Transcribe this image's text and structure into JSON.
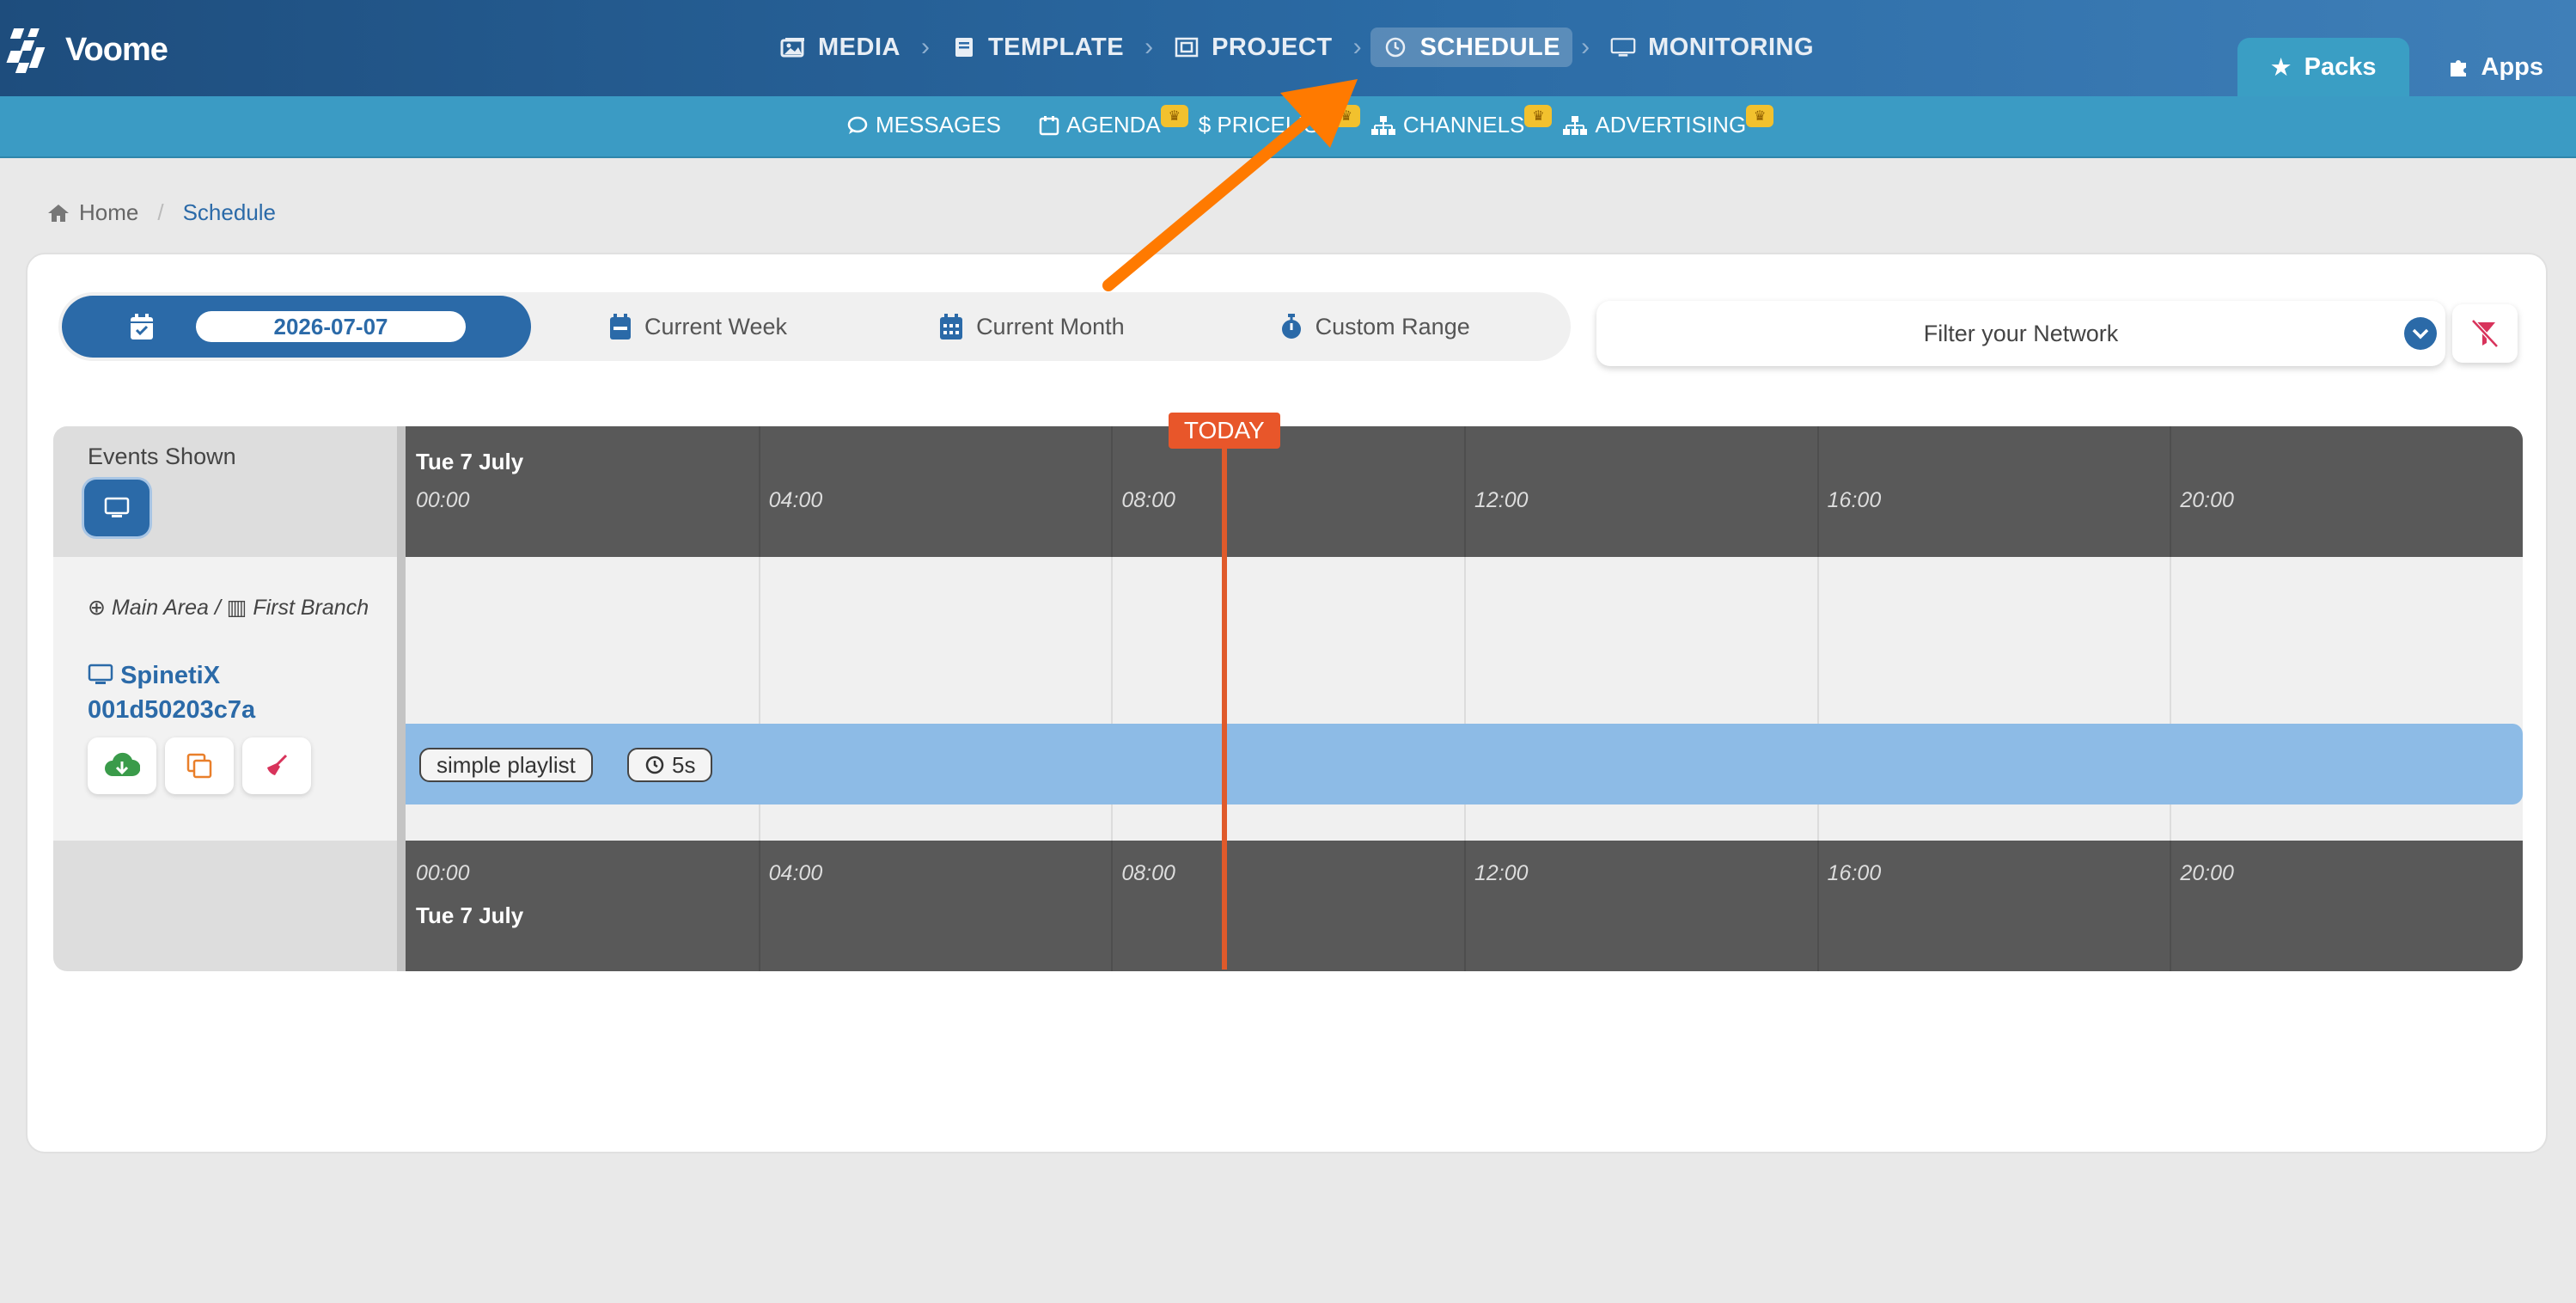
{
  "brand": {
    "name": "Voome"
  },
  "nav": {
    "items": [
      {
        "label": "MEDIA",
        "icon": "image-icon",
        "active": false
      },
      {
        "label": "TEMPLATE",
        "icon": "book-icon",
        "active": false
      },
      {
        "label": "PROJECT",
        "icon": "frame-icon",
        "active": false
      },
      {
        "label": "SCHEDULE",
        "icon": "clock-icon",
        "active": true
      },
      {
        "label": "MONITORING",
        "icon": "monitor-icon",
        "active": false
      }
    ],
    "tabs": [
      {
        "label": "Packs",
        "icon": "star-icon",
        "active": true
      },
      {
        "label": "Apps",
        "icon": "puzzle-icon",
        "active": false
      }
    ]
  },
  "subnav": {
    "items": [
      {
        "label": "MESSAGES",
        "icon": "chat-icon",
        "premium": false
      },
      {
        "label": "AGENDA",
        "icon": "calendar-icon",
        "premium": true
      },
      {
        "label": "$ PRICELIST",
        "icon": "dollar-icon",
        "premium": true
      },
      {
        "label": "CHANNELS",
        "icon": "sitemap-icon",
        "premium": true
      },
      {
        "label": "ADVERTISING",
        "icon": "sitemap-icon",
        "premium": true
      }
    ]
  },
  "breadcrumb": {
    "home": "Home",
    "current": "Schedule"
  },
  "range": {
    "date": "2026-07-07",
    "options": [
      "Current Week",
      "Current Month",
      "Custom Range"
    ]
  },
  "filter": {
    "placeholder": "Filter your Network"
  },
  "timeline": {
    "events_label": "Events Shown",
    "day": "Tue 7 July",
    "hours": [
      "00:00",
      "04:00",
      "08:00",
      "12:00",
      "16:00",
      "20:00"
    ],
    "today_label": "TODAY",
    "today_hour": 9.3,
    "device": {
      "area": "Main Area /",
      "branch": "First Branch",
      "name": "SpinetiX 001d50203c7a"
    },
    "event": {
      "name": "simple playlist",
      "duration": "5s"
    }
  },
  "colors": {
    "accent": "#2b6aa8",
    "today": "#e8562a",
    "arrow": "#ff7a00"
  }
}
